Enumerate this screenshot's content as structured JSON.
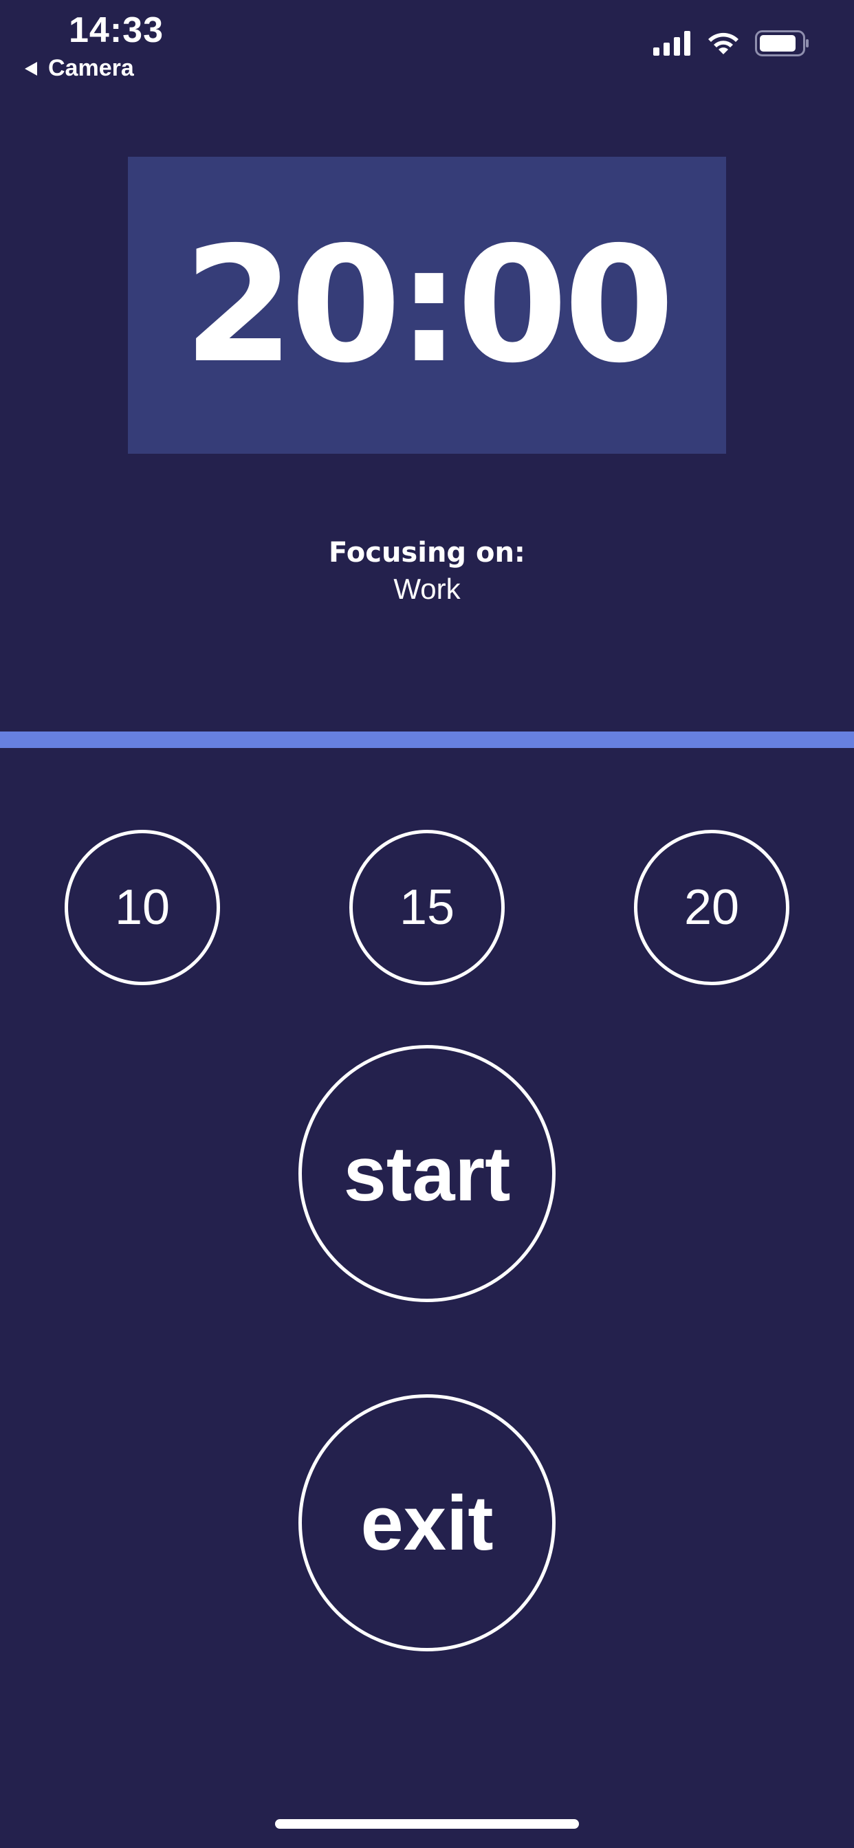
{
  "status_bar": {
    "time": "14:33",
    "back_label": "Camera",
    "icons": [
      "signal-icon",
      "wifi-icon",
      "battery-icon"
    ]
  },
  "timer": {
    "display": "20:00"
  },
  "focus": {
    "title": "Focusing on:",
    "value": "Work"
  },
  "progress": {
    "fraction": 1.0
  },
  "presets": [
    {
      "label": "10"
    },
    {
      "label": "15"
    },
    {
      "label": "20"
    }
  ],
  "actions": {
    "start_label": "start",
    "exit_label": "exit"
  },
  "colors": {
    "background": "#24214d",
    "timer_panel": "#363d78",
    "progress": "#6780e0",
    "foreground": "#ffffff"
  }
}
